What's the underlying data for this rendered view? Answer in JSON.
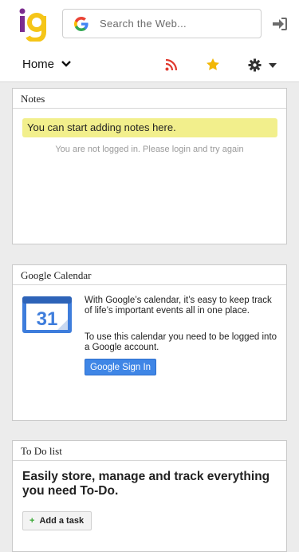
{
  "header": {
    "search_placeholder": "Search the Web...",
    "brand_colors": {
      "i": "#7b2c8f",
      "g": "#f5c518"
    }
  },
  "nav": {
    "home_label": "Home"
  },
  "notes": {
    "title": "Notes",
    "message": "You can start adding notes here.",
    "login_text": "You are not logged in. Please login and try again"
  },
  "calendar": {
    "title": "Google Calendar",
    "icon_day": "31",
    "description": "With Google’s calendar, it’s easy to keep track of life’s important events all in one place.",
    "login_note": "To use this calendar you need to be logged into a Google account.",
    "signin_label": "Google Sign In"
  },
  "todo": {
    "title": "To Do list",
    "heading": "Easily store, manage and track everything you need To-Do.",
    "add_label": "Add a task"
  },
  "icons": [
    "google-g-icon",
    "login-icon",
    "chevron-down-icon",
    "rss-icon",
    "star-icon",
    "gear-icon",
    "caret-down-icon",
    "calendar-icon",
    "plus-icon"
  ]
}
